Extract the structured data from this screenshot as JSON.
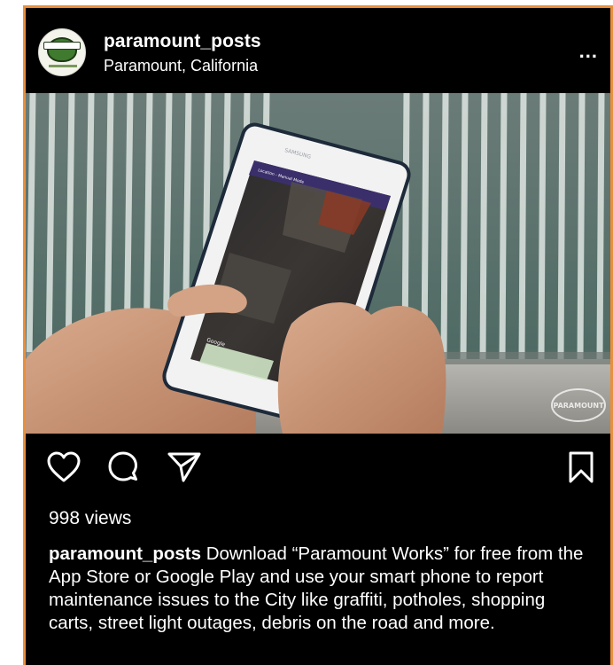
{
  "post": {
    "username": "paramount_posts",
    "location": "Paramount, California",
    "more_label": "...",
    "views": "998 views",
    "caption_user": "paramount_posts",
    "caption_text": "Download “Paramount Works” for free from the App Store or Google Play and use your smart phone to report maintenance issues to the City like graffiti, potholes, shopping carts, street light outages, debris on the road and more."
  },
  "media": {
    "watermark": "PARAMOUNT",
    "phone_brand": "SAMSUNG",
    "phone_screen_title": "Location - Manual Mode",
    "phone_map_label": "Google"
  },
  "icons": {
    "like": "heart-icon",
    "comment": "comment-icon",
    "share": "send-icon",
    "save": "bookmark-icon",
    "more": "more-icon"
  },
  "colors": {
    "frame_accent": "#e98f3c",
    "background": "#000000",
    "text": "#ffffff"
  }
}
